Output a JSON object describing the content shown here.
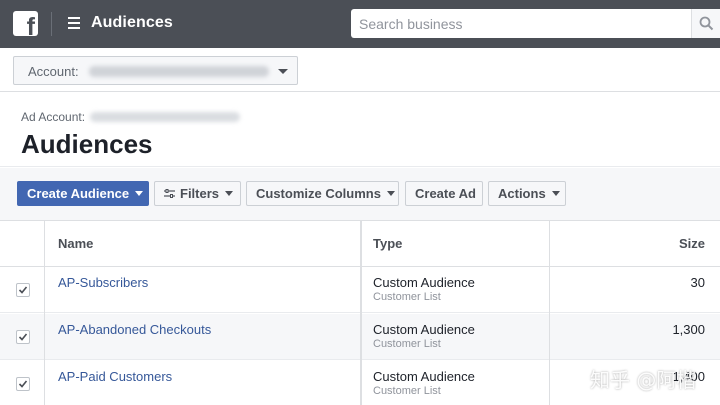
{
  "topbar": {
    "logo_letter": "f",
    "app_title": "Audiences",
    "search_placeholder": "Search business"
  },
  "account_bar": {
    "label": "Account:"
  },
  "header": {
    "ad_account_label": "Ad Account:",
    "page_title": "Audiences"
  },
  "toolbar": {
    "create_audience": "Create Audience",
    "filters": "Filters",
    "customize_columns": "Customize Columns",
    "create_ad": "Create Ad",
    "actions": "Actions"
  },
  "table": {
    "columns": {
      "name": "Name",
      "type": "Type",
      "size": "Size"
    },
    "rows": [
      {
        "checked": true,
        "name": "AP-Subscribers",
        "type": "Custom Audience",
        "subtype": "Customer List",
        "size": "30"
      },
      {
        "checked": true,
        "name": "AP-Abandoned Checkouts",
        "type": "Custom Audience",
        "subtype": "Customer List",
        "size": "1,300"
      },
      {
        "checked": true,
        "name": "AP-Paid Customers",
        "type": "Custom Audience",
        "subtype": "Customer List",
        "size": "1,400"
      }
    ]
  },
  "watermark": "知乎 @阿楷",
  "colors": {
    "topbar": "#4b4f56",
    "primary_button": "#4267b2",
    "link": "#365899"
  }
}
